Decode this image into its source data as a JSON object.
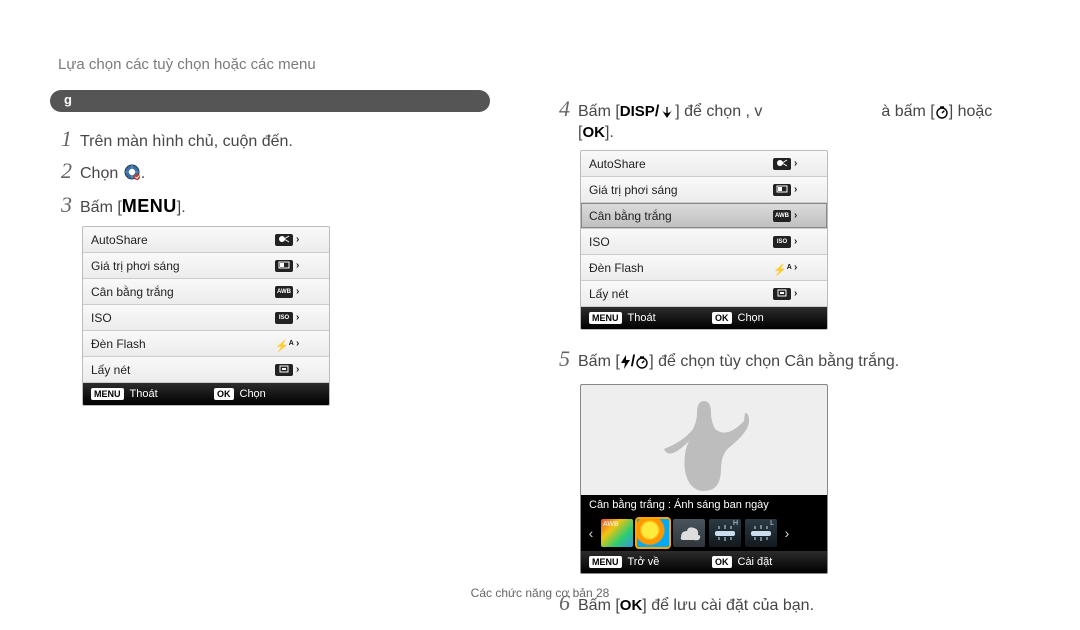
{
  "header": {
    "title": "Lựa chọn các tuỳ chọn hoặc các menu"
  },
  "pill": {
    "mark": "ɡ"
  },
  "steps_left": {
    "s1": "Trên màn hình chủ, cuộn đến.",
    "s2": "Chọn ",
    "s3_prefix": "Bấm [",
    "s3_suffix": "]."
  },
  "menu_labels": {
    "menu": "MENU",
    "ok": "OK",
    "disp": "DISP"
  },
  "cam_menu": {
    "items": [
      {
        "label": "AutoShare",
        "iconText": ""
      },
      {
        "label": "Giá trị phơi sáng",
        "iconText": ""
      },
      {
        "label": "Cân bằng trắng",
        "iconText": ""
      },
      {
        "label": "ISO",
        "iconText": "ISO"
      },
      {
        "label": "Đèn Flash",
        "iconText": ""
      },
      {
        "label": "Lấy nét",
        "iconText": ""
      }
    ],
    "footer_left_label": "Thoát",
    "footer_right_label": "Chọn"
  },
  "steps_right": {
    "s4_a": "Bấm [",
    "s4_b": "] để chọn , v",
    "s4_c": "à bấm [",
    "s4_d": "] hoặc [",
    "s4_e": "].",
    "s5_prefix": "Bấm [",
    "s5_mid": "/",
    "s5_suffix": "] để chọn tùy chọn Cân bằng trắng.",
    "s6_prefix": "Bấm [",
    "s6_suffix": "] để lưu cài đặt của bạn."
  },
  "wb": {
    "caption": "Cân bằng trắng : Ánh sáng ban ngày",
    "footer_left_label": "Trở về",
    "footer_right_label": "Cài đặt"
  },
  "footer": {
    "text": "Các chức năng cơ bản  28"
  }
}
